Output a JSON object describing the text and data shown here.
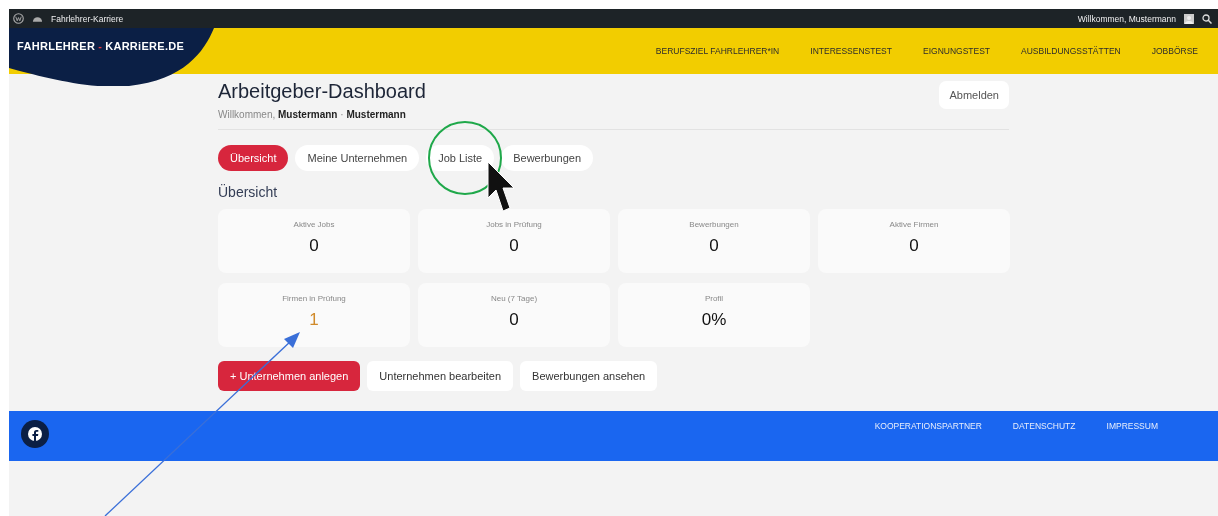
{
  "admin_bar": {
    "site_title": "Fahrlehrer-Karriere",
    "greeting": "Willkommen, Mustermann"
  },
  "header": {
    "logo": [
      {
        "text": "FAHRLEHRER",
        "accent": false
      },
      {
        "text": "-",
        "accent": true
      },
      {
        "text": "KARRiERE.DE",
        "accent": false
      }
    ],
    "nav": [
      "BERUFSZIEL FAHRLEHRER*IN",
      "INTERESSENSTEST",
      "EIGNUNGSTEST",
      "AUSBILDUNGSSTÄTTEN",
      "JOBBÖRSE"
    ]
  },
  "dashboard": {
    "title": "Arbeitgeber-Dashboard",
    "welcome": {
      "prefix": "Willkommen,",
      "names": [
        "Mustermann",
        "Mustermann"
      ],
      "separator": "·"
    },
    "logout_button": "Abmelden",
    "tabs": [
      {
        "label": "Übersicht",
        "selected": true
      },
      {
        "label": "Meine Unternehmen",
        "selected": false
      },
      {
        "label": "Job Liste",
        "selected": false
      },
      {
        "label": "Bewerbungen",
        "selected": false
      }
    ],
    "section_title": "Übersicht",
    "stats": [
      {
        "label": "Aktive Jobs",
        "value": "0",
        "highlight": false
      },
      {
        "label": "Jobs in Prüfung",
        "value": "0",
        "highlight": false
      },
      {
        "label": "Bewerbungen",
        "value": "0",
        "highlight": false
      },
      {
        "label": "Aktive Firmen",
        "value": "0",
        "highlight": false
      },
      {
        "label": "Firmen in Prüfung",
        "value": "1",
        "highlight": true
      },
      {
        "label": "Neu (7 Tage)",
        "value": "0",
        "highlight": false
      },
      {
        "label": "Profil",
        "value": "0%",
        "highlight": false
      }
    ],
    "actions": [
      {
        "label": "+ Unternehmen anlegen",
        "primary": true
      },
      {
        "label": "Unternehmen bearbeiten",
        "primary": false
      },
      {
        "label": "Bewerbungen ansehen",
        "primary": false
      }
    ]
  },
  "footer": {
    "links": [
      "KOOPERATIONSPARTNER",
      "DATENSCHUTZ",
      "IMPRESSUM"
    ]
  }
}
